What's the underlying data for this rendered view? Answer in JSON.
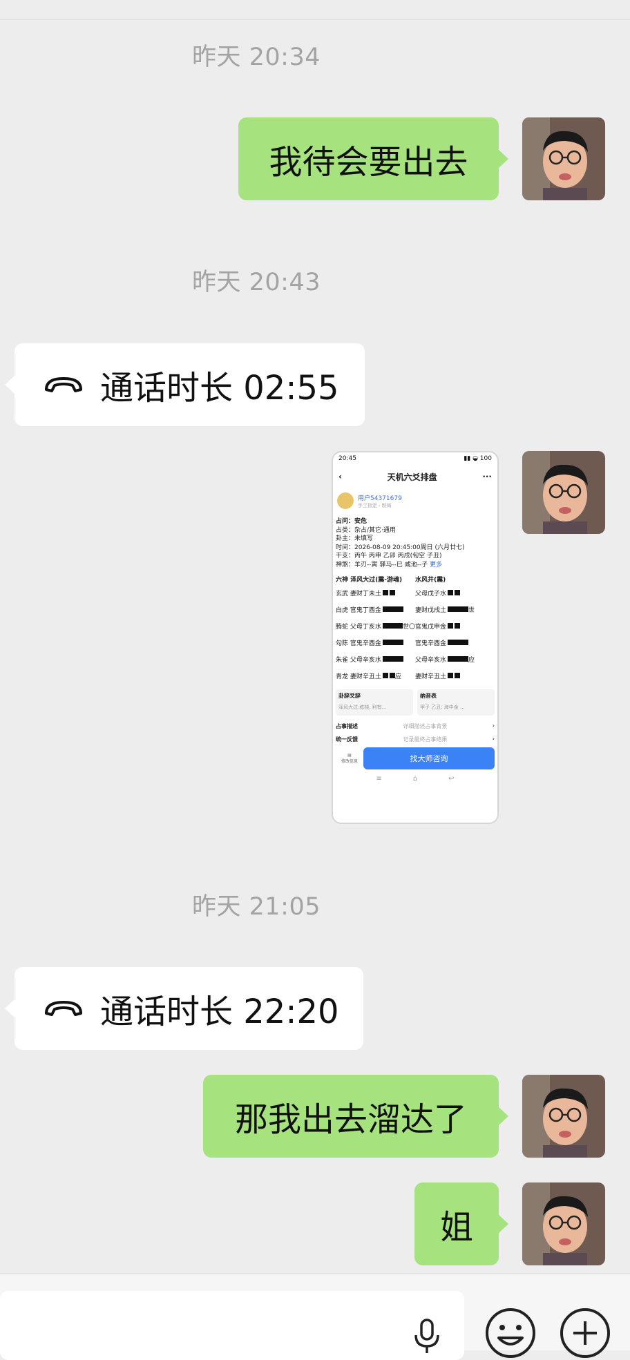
{
  "timestamps": [
    "昨天 20:34",
    "昨天 20:43",
    "昨天 21:05"
  ],
  "messages": {
    "m1": "我待会要出去",
    "call1": "通话时长 02:55",
    "call2": "通话时长 22:20",
    "m2": "那我出去溜达了",
    "m3": "姐"
  },
  "screenshot": {
    "status_time": "20:45",
    "title": "天机六爻排盘",
    "more": "···",
    "user_name": "用户54371679",
    "user_sub": "手工指定 · 制局",
    "rows": [
      "占问：安危",
      "占类：杂占/其它·通用",
      "卦主：未填写",
      "时间：2026-08-09 20:45:00周日 (六月廿七)",
      "干支：丙午 丙申 乙卯 丙戌(旬空 子丑)",
      "神煞：羊刃--寅  驿马--巳  咸池--子"
    ],
    "more_link": "更多",
    "left_header": "六神  泽风大过(震-游魂)",
    "right_header": "水风井(震)",
    "left_lines": [
      "玄武 妻财丁未土",
      "白虎 官鬼丁酉金",
      "腾蛇 父母丁亥水",
      "勾陈 官鬼辛酉金",
      "朱雀 父母辛亥水",
      "青龙 妻财辛丑土"
    ],
    "right_lines": [
      "父母戊子水",
      "妻财戊戌土",
      "官鬼戊申金",
      "官鬼辛酉金",
      "父母辛亥水",
      "妻财辛丑土"
    ],
    "marks": [
      "世〇",
      "应",
      "世",
      "应"
    ],
    "card1_title": "卦辞爻辞",
    "card1_sub": "泽风大过:栋桡, 利有...",
    "card2_title": "纳音表",
    "card2_sub": "甲子 乙丑: 海中金 ...",
    "desc_label": "占事描述",
    "desc_placeholder": "详细描述占事背景",
    "feedback_label": "统一反馈",
    "feedback_placeholder": "记录最终占事结果",
    "save_label": "修改信息",
    "cta": "找大师咨询"
  },
  "colors": {
    "bubble_me": "#a6e37f",
    "background": "#ededed",
    "bubble_other": "#ffffff"
  }
}
